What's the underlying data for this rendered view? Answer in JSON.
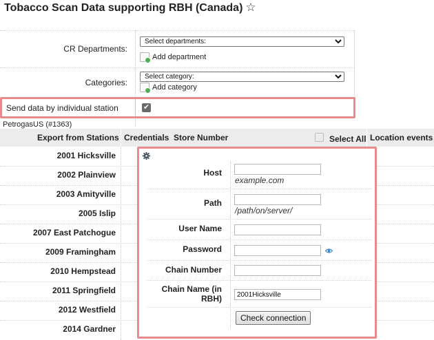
{
  "page": {
    "title": "Tobacco Scan Data supporting RBH (Canada)",
    "star": "☆"
  },
  "form": {
    "cr_departments": {
      "label": "CR Departments:",
      "select": "Select departments:",
      "add": "Add department"
    },
    "categories": {
      "label": "Categories:",
      "select": "Select category:",
      "add": "Add category"
    },
    "send_by_station": {
      "label": "Send data by individual station",
      "checked": true,
      "check_glyph": "✔"
    }
  },
  "company": "PetrogasUS (#1363)",
  "table": {
    "headers": {
      "export": "Export from Stations",
      "credentials": "Credentials",
      "store": "Store Number",
      "select_all": "Select All",
      "location_events": "Location events"
    },
    "stations": [
      "2001 Hicksville",
      "2002 Plainview",
      "2003 Amityville",
      "2005 Islip",
      "2007 East Patchogue",
      "2009 Framingham",
      "2010 Hempstead",
      "2011 Springfield",
      "2012 Westfield",
      "2014 Gardner"
    ]
  },
  "credentials": {
    "host": {
      "label": "Host",
      "value": "",
      "hint": "example.com"
    },
    "path": {
      "label": "Path",
      "value": "",
      "hint": "/path/on/server/"
    },
    "user": {
      "label": "User Name",
      "value": ""
    },
    "password": {
      "label": "Password",
      "value": ""
    },
    "chain_number": {
      "label": "Chain Number",
      "value": ""
    },
    "chain_name": {
      "label": "Chain Name (in RBH)",
      "value": "2001Hicksville"
    },
    "check_button": "Check connection"
  },
  "colors": {
    "highlight": "#e88a8e",
    "header_bg": "#ececec",
    "checkbox": "#6a6a6a",
    "eye": "#3a86c8",
    "add_badge": "#4caf50"
  }
}
